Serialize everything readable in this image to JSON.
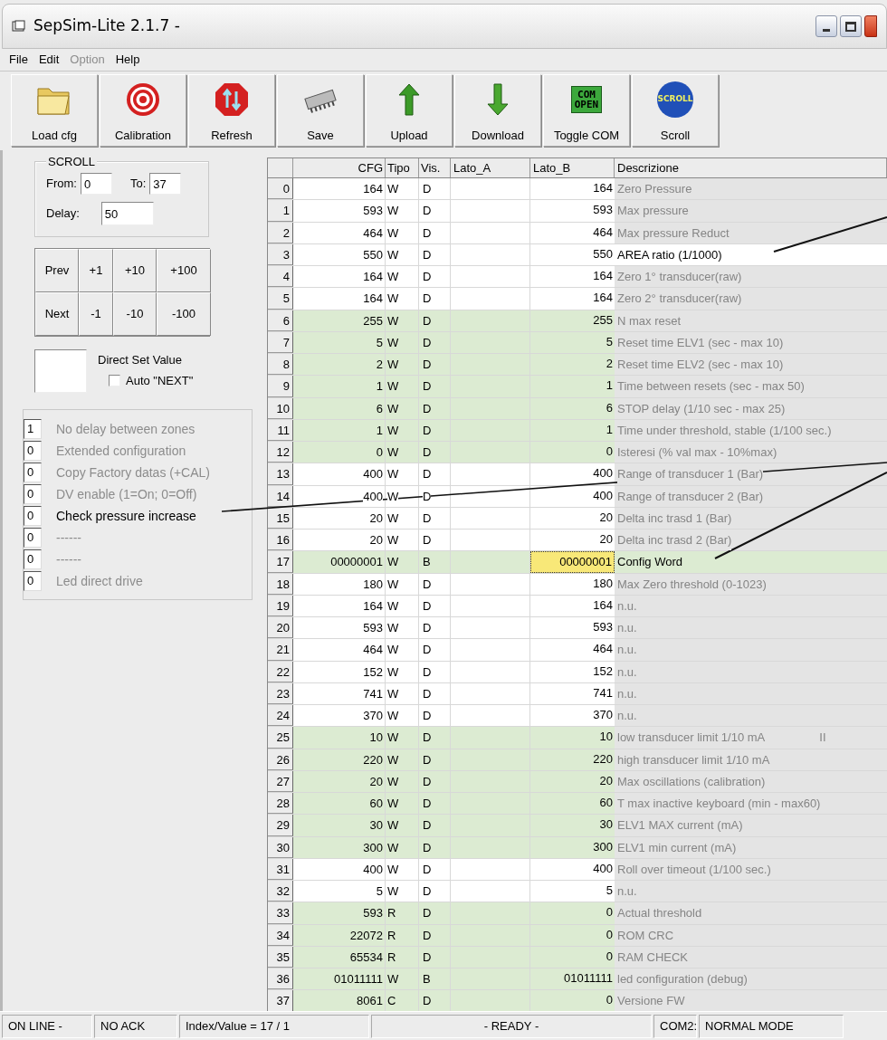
{
  "window": {
    "title": "SepSim-Lite 2.1.7 -"
  },
  "menu": [
    {
      "label": "File",
      "disabled": false
    },
    {
      "label": "Edit",
      "disabled": false
    },
    {
      "label": "Option",
      "disabled": true
    },
    {
      "label": "Help",
      "disabled": false
    }
  ],
  "toolbar": [
    {
      "kind": "folder",
      "label": "Load cfg"
    },
    {
      "kind": "target",
      "label": "Calibration"
    },
    {
      "kind": "refresh",
      "label": "Refresh"
    },
    {
      "kind": "chip",
      "label": "Save"
    },
    {
      "kind": "up",
      "label": "Upload"
    },
    {
      "kind": "down",
      "label": "Download"
    },
    {
      "kind": "com",
      "label": "Toggle COM",
      "badge": [
        "COM",
        "OPEN"
      ]
    },
    {
      "kind": "scroll",
      "label": "Scroll",
      "badge": [
        "SCROLL"
      ]
    }
  ],
  "scroll_group": {
    "title": "SCROLL",
    "from_label": "From:",
    "from": "0",
    "to_label": "To:",
    "to": "37",
    "delay_label": "Delay:",
    "delay": "50"
  },
  "step_buttons": [
    [
      "Prev",
      "+1",
      "+10",
      "+100"
    ],
    [
      "Next",
      "-1",
      "-10",
      "-100"
    ]
  ],
  "direct_set": {
    "label": "Direct Set Value",
    "auto_next": {
      "label": "Auto \"NEXT\"",
      "checked": false
    }
  },
  "flags": [
    {
      "value": "1",
      "label": "No delay between zones",
      "enabled": false
    },
    {
      "value": "0",
      "label": "Extended configuration",
      "enabled": false
    },
    {
      "value": "0",
      "label": "Copy Factory datas (+CAL)",
      "enabled": false
    },
    {
      "value": "0",
      "label": "DV enable (1=On; 0=Off)",
      "enabled": false
    },
    {
      "value": "0",
      "label": "Check pressure increase",
      "enabled": true
    },
    {
      "value": "0",
      "label": "------",
      "enabled": false
    },
    {
      "value": "0",
      "label": "------",
      "enabled": false
    },
    {
      "value": "0",
      "label": "Led direct drive",
      "enabled": false
    }
  ],
  "table": {
    "columns": [
      "CFG",
      "Tipo",
      "Vis.",
      "Lato_A",
      "Lato_B",
      "Descrizione"
    ],
    "rows": [
      {
        "index": "0",
        "cfg": "164",
        "tipo": "W",
        "vis": "D",
        "lato_b": "164",
        "descrizione": "Zero Pressure",
        "shaded": false,
        "enabled": false,
        "selected": false
      },
      {
        "index": "1",
        "cfg": "593",
        "tipo": "W",
        "vis": "D",
        "lato_b": "593",
        "descrizione": "Max pressure",
        "shaded": false,
        "enabled": false,
        "selected": false
      },
      {
        "index": "2",
        "cfg": "464",
        "tipo": "W",
        "vis": "D",
        "lato_b": "464",
        "descrizione": "Max pressure Reduct",
        "shaded": false,
        "enabled": false,
        "selected": false
      },
      {
        "index": "3",
        "cfg": "550",
        "tipo": "W",
        "vis": "D",
        "lato_b": "550",
        "descrizione": "AREA ratio (1/1000)",
        "shaded": false,
        "enabled": true,
        "selected": false
      },
      {
        "index": "4",
        "cfg": "164",
        "tipo": "W",
        "vis": "D",
        "lato_b": "164",
        "descrizione": "Zero 1° transducer(raw)",
        "shaded": false,
        "enabled": false,
        "selected": false
      },
      {
        "index": "5",
        "cfg": "164",
        "tipo": "W",
        "vis": "D",
        "lato_b": "164",
        "descrizione": "Zero 2° transducer(raw)",
        "shaded": false,
        "enabled": false,
        "selected": false
      },
      {
        "index": "6",
        "cfg": "255",
        "tipo": "W",
        "vis": "D",
        "lato_b": "255",
        "descrizione": "N max reset",
        "shaded": true,
        "enabled": false,
        "selected": false
      },
      {
        "index": "7",
        "cfg": "5",
        "tipo": "W",
        "vis": "D",
        "lato_b": "5",
        "descrizione": "Reset time ELV1 (sec - max 10)",
        "shaded": true,
        "enabled": false,
        "selected": false
      },
      {
        "index": "8",
        "cfg": "2",
        "tipo": "W",
        "vis": "D",
        "lato_b": "2",
        "descrizione": "Reset time ELV2 (sec - max 10)",
        "shaded": true,
        "enabled": false,
        "selected": false
      },
      {
        "index": "9",
        "cfg": "1",
        "tipo": "W",
        "vis": "D",
        "lato_b": "1",
        "descrizione": "Time between resets (sec - max 50)",
        "shaded": true,
        "enabled": false,
        "selected": false
      },
      {
        "index": "10",
        "cfg": "6",
        "tipo": "W",
        "vis": "D",
        "lato_b": "6",
        "descrizione": "STOP delay (1/10 sec - max 25)",
        "shaded": true,
        "enabled": false,
        "selected": false
      },
      {
        "index": "11",
        "cfg": "1",
        "tipo": "W",
        "vis": "D",
        "lato_b": "1",
        "descrizione": "Time under threshold, stable (1/100 sec.)",
        "shaded": true,
        "enabled": false,
        "selected": false
      },
      {
        "index": "12",
        "cfg": "0",
        "tipo": "W",
        "vis": "D",
        "lato_b": "0",
        "descrizione": "Isteresi (% val max - 10%max)",
        "shaded": true,
        "enabled": false,
        "selected": false
      },
      {
        "index": "13",
        "cfg": "400",
        "tipo": "W",
        "vis": "D",
        "lato_b": "400",
        "descrizione": "Range of transducer 1 (Bar)",
        "shaded": false,
        "enabled": false,
        "selected": false
      },
      {
        "index": "14",
        "cfg": "400",
        "tipo": "W",
        "vis": "D",
        "lato_b": "400",
        "descrizione": "Range of transducer 2 (Bar)",
        "shaded": false,
        "enabled": false,
        "selected": false
      },
      {
        "index": "15",
        "cfg": "20",
        "tipo": "W",
        "vis": "D",
        "lato_b": "20",
        "descrizione": "Delta inc trasd 1 (Bar)",
        "shaded": false,
        "enabled": false,
        "selected": false
      },
      {
        "index": "16",
        "cfg": "20",
        "tipo": "W",
        "vis": "D",
        "lato_b": "20",
        "descrizione": "Delta inc trasd 2 (Bar)",
        "shaded": false,
        "enabled": false,
        "selected": false
      },
      {
        "index": "17",
        "cfg": "00000001",
        "tipo": "W",
        "vis": "B",
        "lato_b": "00000001",
        "descrizione": "Config Word",
        "shaded": true,
        "enabled": true,
        "selected": true
      },
      {
        "index": "18",
        "cfg": "180",
        "tipo": "W",
        "vis": "D",
        "lato_b": "180",
        "descrizione": "Max Zero threshold (0-1023)",
        "shaded": false,
        "enabled": false,
        "selected": false
      },
      {
        "index": "19",
        "cfg": "164",
        "tipo": "W",
        "vis": "D",
        "lato_b": "164",
        "descrizione": "n.u.",
        "shaded": false,
        "enabled": false,
        "selected": false
      },
      {
        "index": "20",
        "cfg": "593",
        "tipo": "W",
        "vis": "D",
        "lato_b": "593",
        "descrizione": "n.u.",
        "shaded": false,
        "enabled": false,
        "selected": false
      },
      {
        "index": "21",
        "cfg": "464",
        "tipo": "W",
        "vis": "D",
        "lato_b": "464",
        "descrizione": "n.u.",
        "shaded": false,
        "enabled": false,
        "selected": false
      },
      {
        "index": "22",
        "cfg": "152",
        "tipo": "W",
        "vis": "D",
        "lato_b": "152",
        "descrizione": "n.u.",
        "shaded": false,
        "enabled": false,
        "selected": false
      },
      {
        "index": "23",
        "cfg": "741",
        "tipo": "W",
        "vis": "D",
        "lato_b": "741",
        "descrizione": "n.u.",
        "shaded": false,
        "enabled": false,
        "selected": false
      },
      {
        "index": "24",
        "cfg": "370",
        "tipo": "W",
        "vis": "D",
        "lato_b": "370",
        "descrizione": "n.u.",
        "shaded": false,
        "enabled": false,
        "selected": false
      },
      {
        "index": "25",
        "cfg": "10",
        "tipo": "W",
        "vis": "D",
        "lato_b": "10",
        "descrizione": "low transducer limit 1/10 mA",
        "extra": "II",
        "shaded": true,
        "enabled": false,
        "selected": false
      },
      {
        "index": "26",
        "cfg": "220",
        "tipo": "W",
        "vis": "D",
        "lato_b": "220",
        "descrizione": "high transducer limit 1/10 mA",
        "shaded": true,
        "enabled": false,
        "selected": false
      },
      {
        "index": "27",
        "cfg": "20",
        "tipo": "W",
        "vis": "D",
        "lato_b": "20",
        "descrizione": "Max oscillations (calibration)",
        "shaded": true,
        "enabled": false,
        "selected": false
      },
      {
        "index": "28",
        "cfg": "60",
        "tipo": "W",
        "vis": "D",
        "lato_b": "60",
        "descrizione": "T max inactive keyboard (min - max60)",
        "shaded": true,
        "enabled": false,
        "selected": false
      },
      {
        "index": "29",
        "cfg": "30",
        "tipo": "W",
        "vis": "D",
        "lato_b": "30",
        "descrizione": "ELV1 MAX current (mA)",
        "shaded": true,
        "enabled": false,
        "selected": false
      },
      {
        "index": "30",
        "cfg": "300",
        "tipo": "W",
        "vis": "D",
        "lato_b": "300",
        "descrizione": "ELV1 min current (mA)",
        "shaded": true,
        "enabled": false,
        "selected": false
      },
      {
        "index": "31",
        "cfg": "400",
        "tipo": "W",
        "vis": "D",
        "lato_b": "400",
        "descrizione": "Roll over timeout (1/100 sec.)",
        "shaded": false,
        "enabled": false,
        "selected": false
      },
      {
        "index": "32",
        "cfg": "5",
        "tipo": "W",
        "vis": "D",
        "lato_b": "5",
        "descrizione": "n.u.",
        "shaded": false,
        "enabled": false,
        "selected": false
      },
      {
        "index": "33",
        "cfg": "593",
        "tipo": "R",
        "vis": "D",
        "lato_b": "0",
        "descrizione": "Actual threshold",
        "shaded": true,
        "enabled": false,
        "selected": false
      },
      {
        "index": "34",
        "cfg": "22072",
        "tipo": "R",
        "vis": "D",
        "lato_b": "0",
        "descrizione": "ROM CRC",
        "shaded": true,
        "enabled": false,
        "selected": false
      },
      {
        "index": "35",
        "cfg": "65534",
        "tipo": "R",
        "vis": "D",
        "lato_b": "0",
        "descrizione": "RAM CHECK",
        "shaded": true,
        "enabled": false,
        "selected": false
      },
      {
        "index": "36",
        "cfg": "01011111",
        "tipo": "W",
        "vis": "B",
        "lato_b": "01011111",
        "descrizione": "led configuration (debug)",
        "shaded": true,
        "enabled": false,
        "selected": false
      },
      {
        "index": "37",
        "cfg": "8061",
        "tipo": "C",
        "vis": "D",
        "lato_b": "0",
        "descrizione": "Versione FW",
        "shaded": true,
        "enabled": false,
        "selected": false
      }
    ]
  },
  "status_bar": [
    "ON LINE  -",
    "NO ACK",
    "Index/Value = 17 / 1",
    "- READY -",
    "COM2:",
    "NORMAL MODE"
  ]
}
